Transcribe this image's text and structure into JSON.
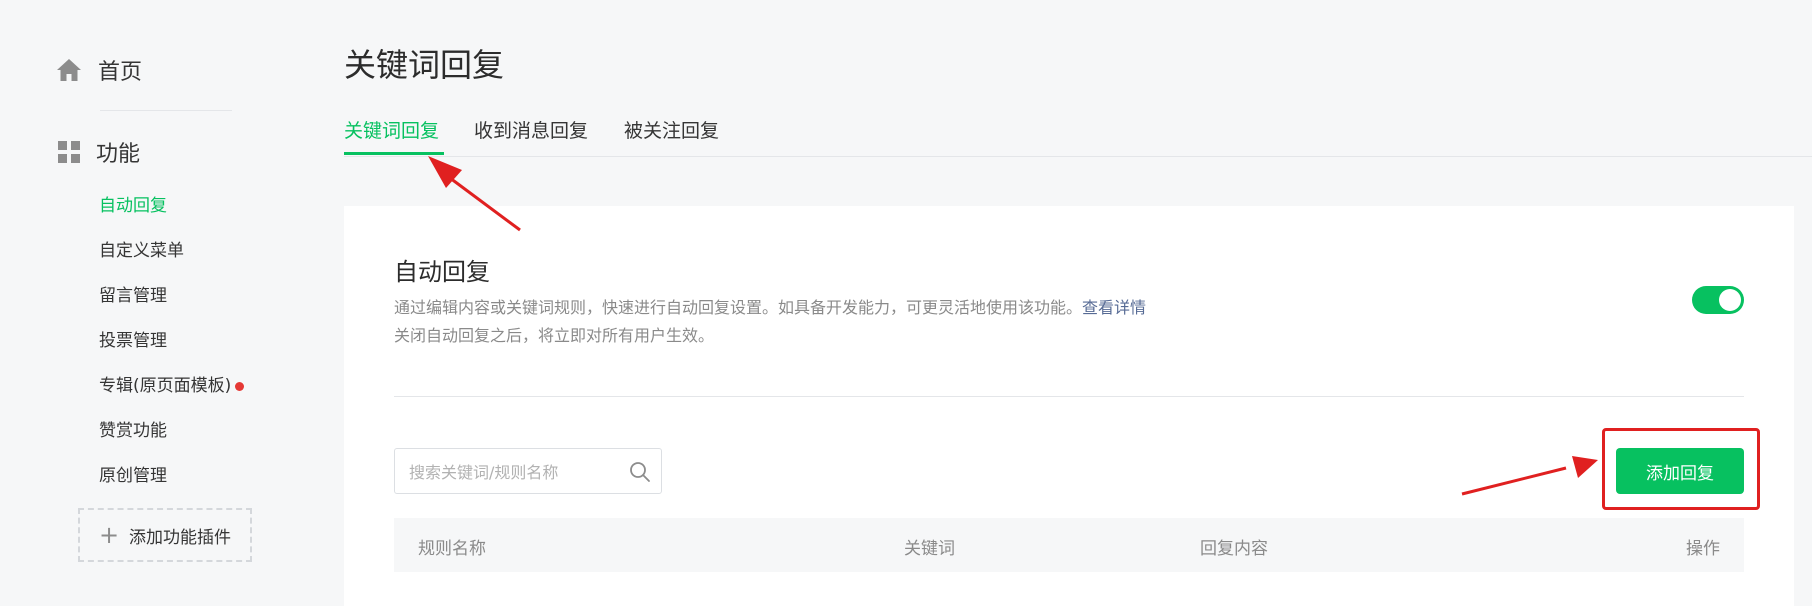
{
  "sidebar": {
    "home_label": "首页",
    "function_label": "功能",
    "items": [
      {
        "label": "自动回复",
        "active": true
      },
      {
        "label": "自定义菜单"
      },
      {
        "label": "留言管理"
      },
      {
        "label": "投票管理"
      },
      {
        "label": "专辑(原页面模板)",
        "badge": true
      },
      {
        "label": "赞赏功能"
      },
      {
        "label": "原创管理"
      }
    ],
    "add_plugin_label": "添加功能插件"
  },
  "page": {
    "title": "关键词回复",
    "tabs": [
      {
        "label": "关键词回复",
        "active": true
      },
      {
        "label": "收到消息回复"
      },
      {
        "label": "被关注回复"
      }
    ]
  },
  "card": {
    "title": "自动回复",
    "description": "通过编辑内容或关键词规则，快速进行自动回复设置。如具备开发能力，可更灵活地使用该功能。",
    "details_link": "查看详情",
    "note": "关闭自动回复之后，将立即对所有用户生效。",
    "toggle_on": true,
    "search_placeholder": "搜索关键词/规则名称",
    "add_button_label": "添加回复",
    "table_headers": {
      "rule_name": "规则名称",
      "keyword": "关键词",
      "reply_content": "回复内容",
      "actions": "操作"
    }
  },
  "colors": {
    "accent": "#07c160",
    "link": "#576b95",
    "annotation": "#e02020",
    "badge": "#e53935"
  }
}
